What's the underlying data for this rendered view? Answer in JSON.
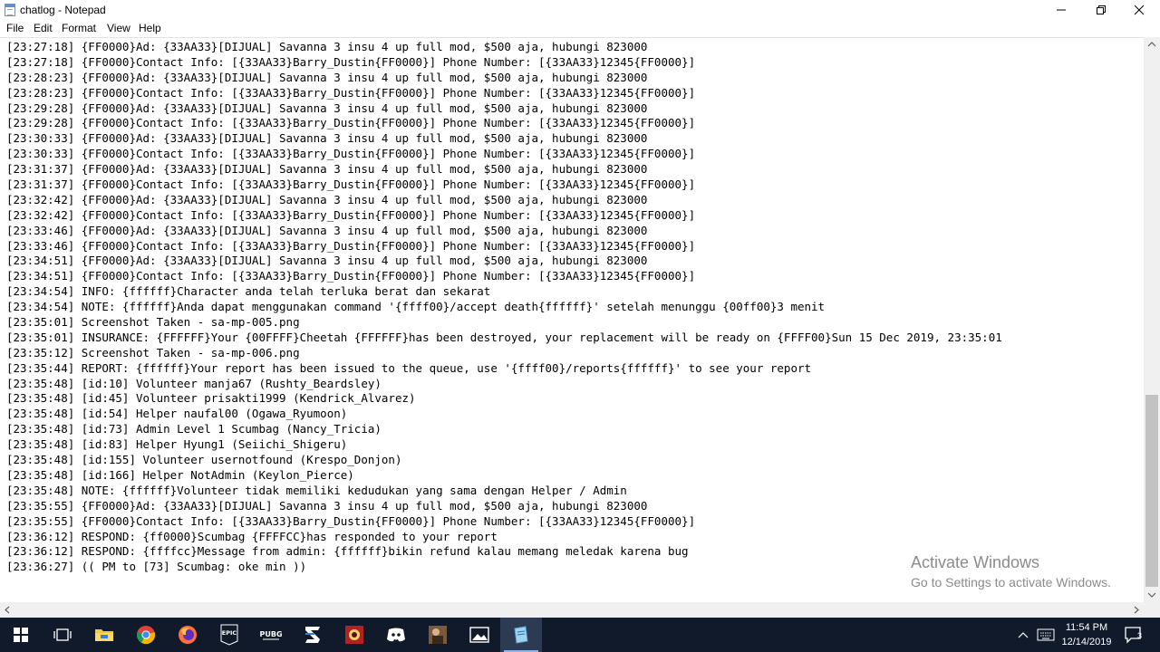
{
  "window": {
    "title": "chatlog - Notepad"
  },
  "menu": {
    "items": [
      "File",
      "Edit",
      "Format",
      "View",
      "Help"
    ]
  },
  "editor": {
    "lines": [
      "[23:27:18] {FF0000}Ad: {33AA33}[DIJUAL] Savanna 3 insu 4 up full mod, $500 aja, hubungi 823000",
      "[23:27:18] {FF0000}Contact Info: [{33AA33}Barry_Dustin{FF0000}] Phone Number: [{33AA33}12345{FF0000}]",
      "[23:28:23] {FF0000}Ad: {33AA33}[DIJUAL] Savanna 3 insu 4 up full mod, $500 aja, hubungi 823000",
      "[23:28:23] {FF0000}Contact Info: [{33AA33}Barry_Dustin{FF0000}] Phone Number: [{33AA33}12345{FF0000}]",
      "[23:29:28] {FF0000}Ad: {33AA33}[DIJUAL] Savanna 3 insu 4 up full mod, $500 aja, hubungi 823000",
      "[23:29:28] {FF0000}Contact Info: [{33AA33}Barry_Dustin{FF0000}] Phone Number: [{33AA33}12345{FF0000}]",
      "[23:30:33] {FF0000}Ad: {33AA33}[DIJUAL] Savanna 3 insu 4 up full mod, $500 aja, hubungi 823000",
      "[23:30:33] {FF0000}Contact Info: [{33AA33}Barry_Dustin{FF0000}] Phone Number: [{33AA33}12345{FF0000}]",
      "[23:31:37] {FF0000}Ad: {33AA33}[DIJUAL] Savanna 3 insu 4 up full mod, $500 aja, hubungi 823000",
      "[23:31:37] {FF0000}Contact Info: [{33AA33}Barry_Dustin{FF0000}] Phone Number: [{33AA33}12345{FF0000}]",
      "[23:32:42] {FF0000}Ad: {33AA33}[DIJUAL] Savanna 3 insu 4 up full mod, $500 aja, hubungi 823000",
      "[23:32:42] {FF0000}Contact Info: [{33AA33}Barry_Dustin{FF0000}] Phone Number: [{33AA33}12345{FF0000}]",
      "[23:33:46] {FF0000}Ad: {33AA33}[DIJUAL] Savanna 3 insu 4 up full mod, $500 aja, hubungi 823000",
      "[23:33:46] {FF0000}Contact Info: [{33AA33}Barry_Dustin{FF0000}] Phone Number: [{33AA33}12345{FF0000}]",
      "[23:34:51] {FF0000}Ad: {33AA33}[DIJUAL] Savanna 3 insu 4 up full mod, $500 aja, hubungi 823000",
      "[23:34:51] {FF0000}Contact Info: [{33AA33}Barry_Dustin{FF0000}] Phone Number: [{33AA33}12345{FF0000}]",
      "[23:34:54] INFO: {ffffff}Character anda telah terluka berat dan sekarat",
      "[23:34:54] NOTE: {ffffff}Anda dapat menggunakan command '{ffff00}/accept death{ffffff}' setelah menunggu {00ff00}3 menit",
      "[23:35:01] Screenshot Taken - sa-mp-005.png",
      "[23:35:01] INSURANCE: {FFFFFF}Your {00FFFF}Cheetah {FFFFFF}has been destroyed, your replacement will be ready on {FFFF00}Sun 15 Dec 2019, 23:35:01",
      "[23:35:12] Screenshot Taken - sa-mp-006.png",
      "[23:35:44] REPORT: {ffffff}Your report has been issued to the queue, use '{ffff00}/reports{ffffff}' to see your report",
      "[23:35:48] [id:10] Volunteer manja67 (Rushty_Beardsley)",
      "[23:35:48] [id:45] Volunteer prisakti1999 (Kendrick_Alvarez)",
      "[23:35:48] [id:54] Helper naufal00 (Ogawa_Ryumoon)",
      "[23:35:48] [id:73] Admin Level 1 Scumbag (Nancy_Tricia)",
      "[23:35:48] [id:83] Helper Hyung1 (Seiichi_Shigeru)",
      "[23:35:48] [id:155] Volunteer usernotfound (Krespo_Donjon)",
      "[23:35:48] [id:166] Helper NotAdmin (Keylon_Pierce)",
      "[23:35:48] NOTE: {ffffff}Volunteer tidak memiliki kedudukan yang sama dengan Helper / Admin",
      "[23:35:55] {FF0000}Ad: {33AA33}[DIJUAL] Savanna 3 insu 4 up full mod, $500 aja, hubungi 823000",
      "[23:35:55] {FF0000}Contact Info: [{33AA33}Barry_Dustin{FF0000}] Phone Number: [{33AA33}12345{FF0000}]",
      "[23:36:12] RESPOND: {ff0000}Scumbag {FFFFCC}has responded to your report",
      "[23:36:12] RESPOND: {ffffcc}Message from admin: {ffffff}bikin refund kalau memang meledak karena bug",
      "[23:36:27] (( PM to [73] Scumbag: oke min ))"
    ]
  },
  "watermark": {
    "line1": "Activate Windows",
    "line2": "Go to Settings to activate Windows."
  },
  "taskbar": {
    "apps": [
      "start",
      "task-view",
      "file-explorer",
      "chrome",
      "firefox",
      "epic-games",
      "pubg",
      "zune",
      "game-app",
      "discord",
      "game-app-2",
      "photos",
      "notepad"
    ],
    "clock_time": "11:54 PM",
    "clock_date": "12/14/2019",
    "notification_count": "3",
    "icons": {
      "epic_label": "EPIC",
      "pubg_label": "PUBG"
    }
  }
}
